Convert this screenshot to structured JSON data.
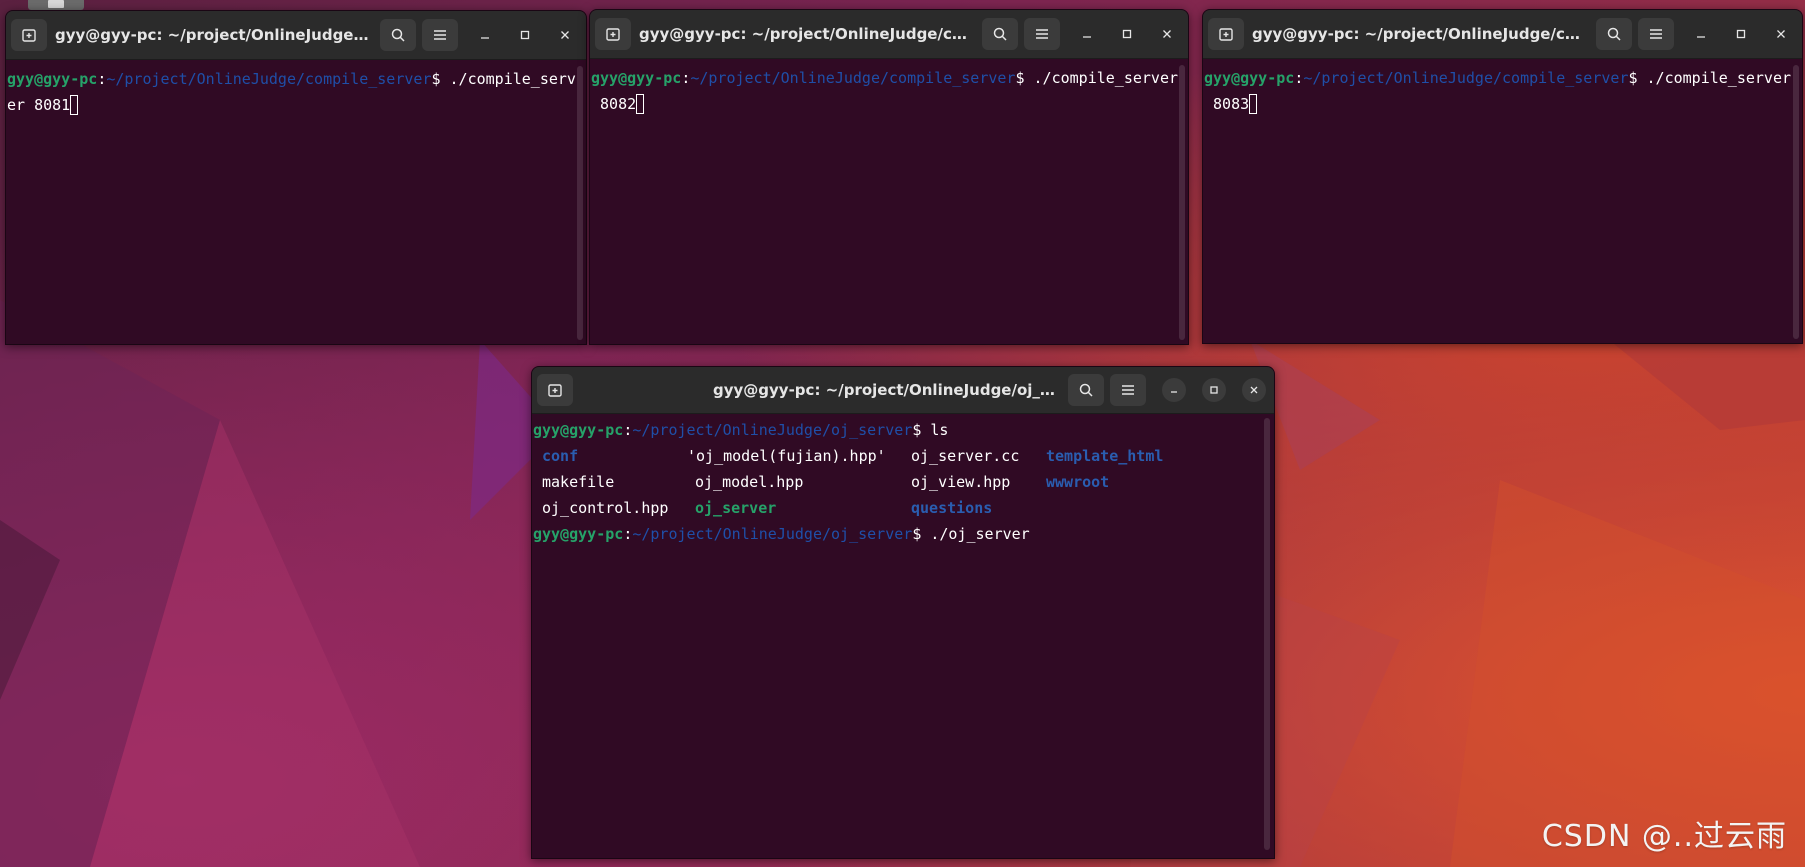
{
  "terminals": [
    {
      "title": "gyy@gyy-pc: ~/project/OnlineJudge/co...",
      "user": "gyy@gyy-pc",
      "path": "~/project/OnlineJudge/compile_server",
      "command": "$ ./compile_serv",
      "wrap": "er 8081"
    },
    {
      "title": "gyy@gyy-pc: ~/project/OnlineJudge/com...",
      "user": "gyy@gyy-pc",
      "path": "~/project/OnlineJudge/compile_server",
      "command": "$ ./compile_server",
      "wrap": " 8082"
    },
    {
      "title": "gyy@gyy-pc: ~/project/OnlineJudge/com...",
      "user": "gyy@gyy-pc",
      "path": "~/project/OnlineJudge/compile_server",
      "command": "$ ./compile_server",
      "wrap": " 8083"
    }
  ],
  "main_terminal": {
    "title": "gyy@gyy-pc: ~/project/OnlineJudge/oj_server",
    "user": "gyy@gyy-pc",
    "path": "~/project/OnlineJudge/oj_server",
    "cmd1": "$ ls",
    "cmd2": "$ ./oj_server",
    "ls": {
      "row1": [
        "conf",
        "'oj_model(fujian).hpp'",
        "oj_server.cc",
        "template_html"
      ],
      "row2": [
        "makefile",
        "oj_model.hpp",
        "oj_view.hpp",
        "wwwroot"
      ],
      "row3": [
        "oj_control.hpp",
        "oj_server",
        "questions"
      ]
    }
  },
  "prompt_colon": ":",
  "watermark": "CSDN @..过云雨",
  "icons": [
    "new-tab-icon",
    "search-icon",
    "hamburger-menu-icon",
    "minimize-icon",
    "maximize-icon",
    "close-icon"
  ],
  "colors": {
    "terminal_bg": "#300a24",
    "user_green": "#26a269",
    "path_blue": "#1f4fa8",
    "titlebar": "#2b2b2b"
  }
}
